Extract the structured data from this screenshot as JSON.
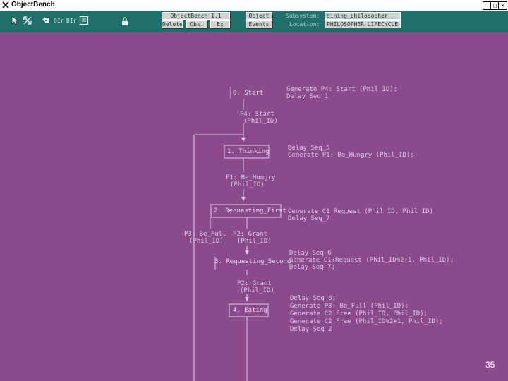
{
  "window": {
    "title": "ObjectBench",
    "minimize": "_",
    "maximize": "□",
    "close": "×"
  },
  "toolbar": {
    "buttons": {
      "objectbench": "ObjectBench 1.1",
      "object": "Object",
      "delete": "Delete",
      "obs": "Obs.",
      "ex": "Ex",
      "events": "Events"
    },
    "subsystem_label": "Subsystem:",
    "subsystem_value": "dining_philosopher",
    "location_label": "Location:",
    "location_value": "PHILOSOPHER LIFECYCLE",
    "icons": [
      "pointer-icon",
      "resize-icon",
      "undo-icon",
      "oir-icon",
      "dir-icon",
      "list-icon",
      "lock-icon"
    ],
    "icon_text": {
      "oir": "OIr",
      "dir": "DIr"
    }
  },
  "diagram": {
    "states": [
      {
        "label": "0. Start",
        "actions": [
          "Generate P4: Start (Phil_ID);",
          "Delay Seq 1"
        ]
      },
      {
        "label": "1. Thinking",
        "actions": [
          "Delay Seq_5",
          "Generate P1: Be_Hungry (Phil_ID);"
        ]
      },
      {
        "label": "2. Requesting_First",
        "actions": [
          "Generate C1 Request (Phil_ID, Phil_ID)",
          "Delay Seq_7"
        ]
      },
      {
        "label": "3. Requesting_Second",
        "actions": [
          "Delay Seq 6",
          "Generate C1:Request (Phil_ID%2+1, Phil_ID);",
          "Delay Seq_7;"
        ]
      },
      {
        "label": "4. Eating",
        "actions": [
          "Delay Seq_6;",
          "Generate P3: Be_Full (Phil_ID);",
          "Generate C2 Free (Phil_ID, Phil_ID);",
          "Generate C2 Free (Phil_ID%2+1, Phil_ID);",
          "Delay Seq_2"
        ]
      }
    ],
    "transitions": [
      {
        "event": "P4: Start",
        "args": "(Phil_ID)"
      },
      {
        "event": "P1: Be_Hungry",
        "args": "(Phil_ID)"
      },
      {
        "event": "P3: Be_Full",
        "args": "(Phil_ID)"
      },
      {
        "event": "P2: Grant",
        "args": "(Phil_ID)"
      },
      {
        "event": "P2: Grant",
        "args": "(Phil_ID)"
      }
    ]
  },
  "colors": {
    "background": "#8c4a8c",
    "toolbar": "#1f6f6a",
    "diagram_line": "#d8d0e8"
  },
  "page_number": "35"
}
